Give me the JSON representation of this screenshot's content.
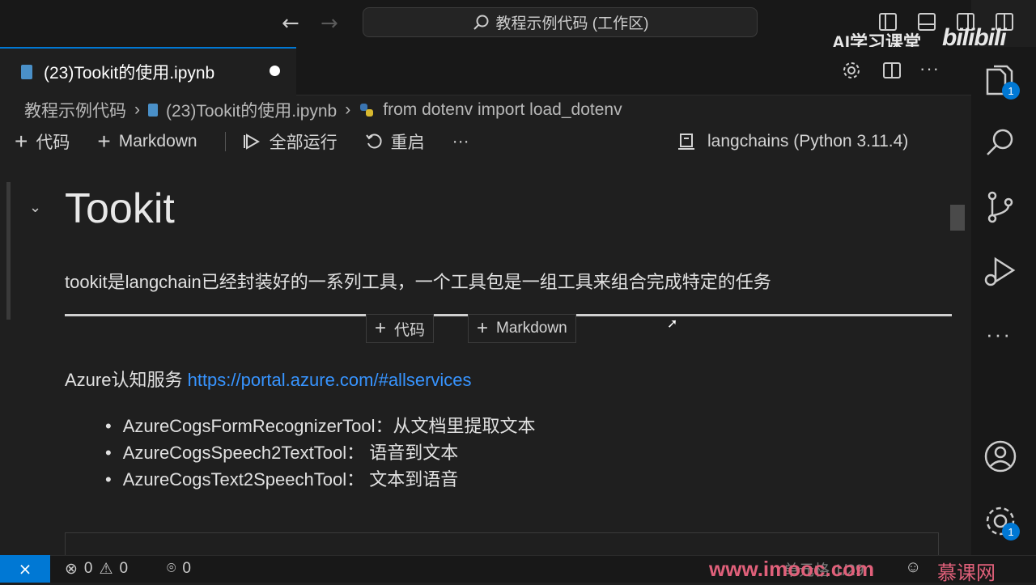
{
  "titlebar": {
    "search_text": "教程示例代码 (工作区)",
    "back_icon": "arrow-left-icon",
    "forward_icon": "arrow-right-icon"
  },
  "watermark": {
    "ai_text": "AI学习课堂",
    "bili_text": "bilibili",
    "imooc_text": "www.imooc.com",
    "mk_text": "慕课网"
  },
  "tab": {
    "label": "(23)Tookit的使用.ipynb"
  },
  "breadcrumb": {
    "items": [
      "教程示例代码",
      "(23)Tookit的使用.ipynb",
      "from dotenv import load_dotenv"
    ]
  },
  "toolbar": {
    "add_code": "代码",
    "add_markdown": "Markdown",
    "run_all": "全部运行",
    "restart": "重启",
    "more": "···",
    "kernel": "langchains (Python 3.11.4)"
  },
  "notebook": {
    "heading": "Tookit",
    "description": "tookit是langchain已经封装好的一系列工具，一个工具包是一组工具来组合完成特定的任务",
    "insert_code": "代码",
    "insert_markdown": "Markdown",
    "azure_prefix": "Azure认知服务 ",
    "azure_link": "https://portal.azure.com/#allservices",
    "bullets": [
      "AzureCogsFormRecognizerTool：从文档里提取文本",
      "AzureCogsSpeech2TextTool： 语音到文本",
      "AzureCogsText2SpeechTool： 文本到语音"
    ]
  },
  "activity": {
    "explorer_badge": "1",
    "settings_badge": "1",
    "more": "···"
  },
  "statusbar": {
    "errors": "0",
    "warnings": "0",
    "ports": "0",
    "cell_position": "单元格 1/29"
  },
  "colors": {
    "accent": "#0078d4",
    "link": "#3794ff",
    "background": "#1f1f1f",
    "watermark": "#e0607a"
  }
}
